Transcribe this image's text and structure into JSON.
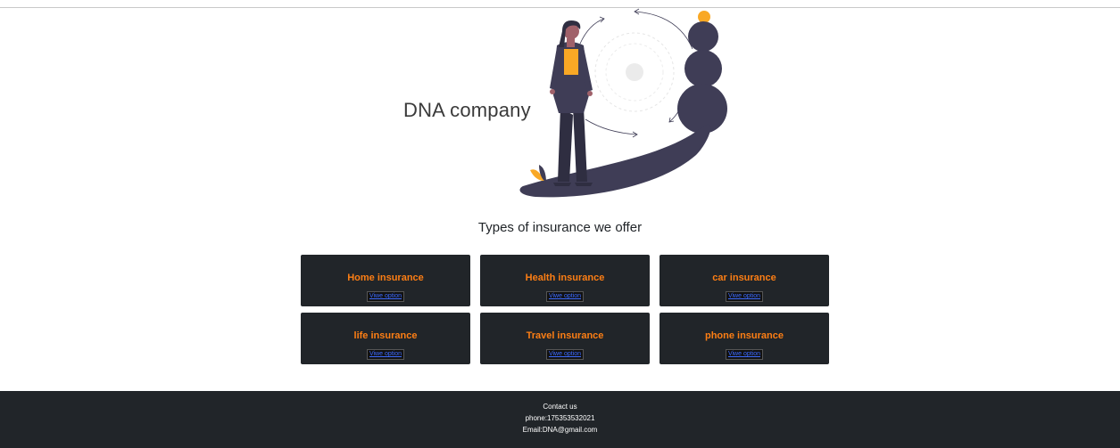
{
  "hero": {
    "brand": "DNA company",
    "illustration_icon": "woman-stacking-stones-illustration"
  },
  "section": {
    "title": "Types of insurance we offer"
  },
  "cards": [
    {
      "title": "Home insurance",
      "link": "Viwe option"
    },
    {
      "title": "Health insurance",
      "link": "Viwe option"
    },
    {
      "title": "car insurance",
      "link": "Viwe option"
    },
    {
      "title": "life insurance",
      "link": "Viwe option"
    },
    {
      "title": "Travel insurance",
      "link": "Viwe option"
    },
    {
      "title": "phone insurance",
      "link": "Viwe option"
    }
  ],
  "footer": {
    "heading": "Contact us",
    "phone": "phone:175353532021",
    "email": "Email:DNA@gmail.com"
  },
  "colors": {
    "card_bg": "#212529",
    "card_title": "#fd7e14",
    "link": "#3d6bff",
    "footer_bg": "#212529",
    "illustration_dark": "#3f3d56",
    "illustration_accent": "#f9a825"
  }
}
